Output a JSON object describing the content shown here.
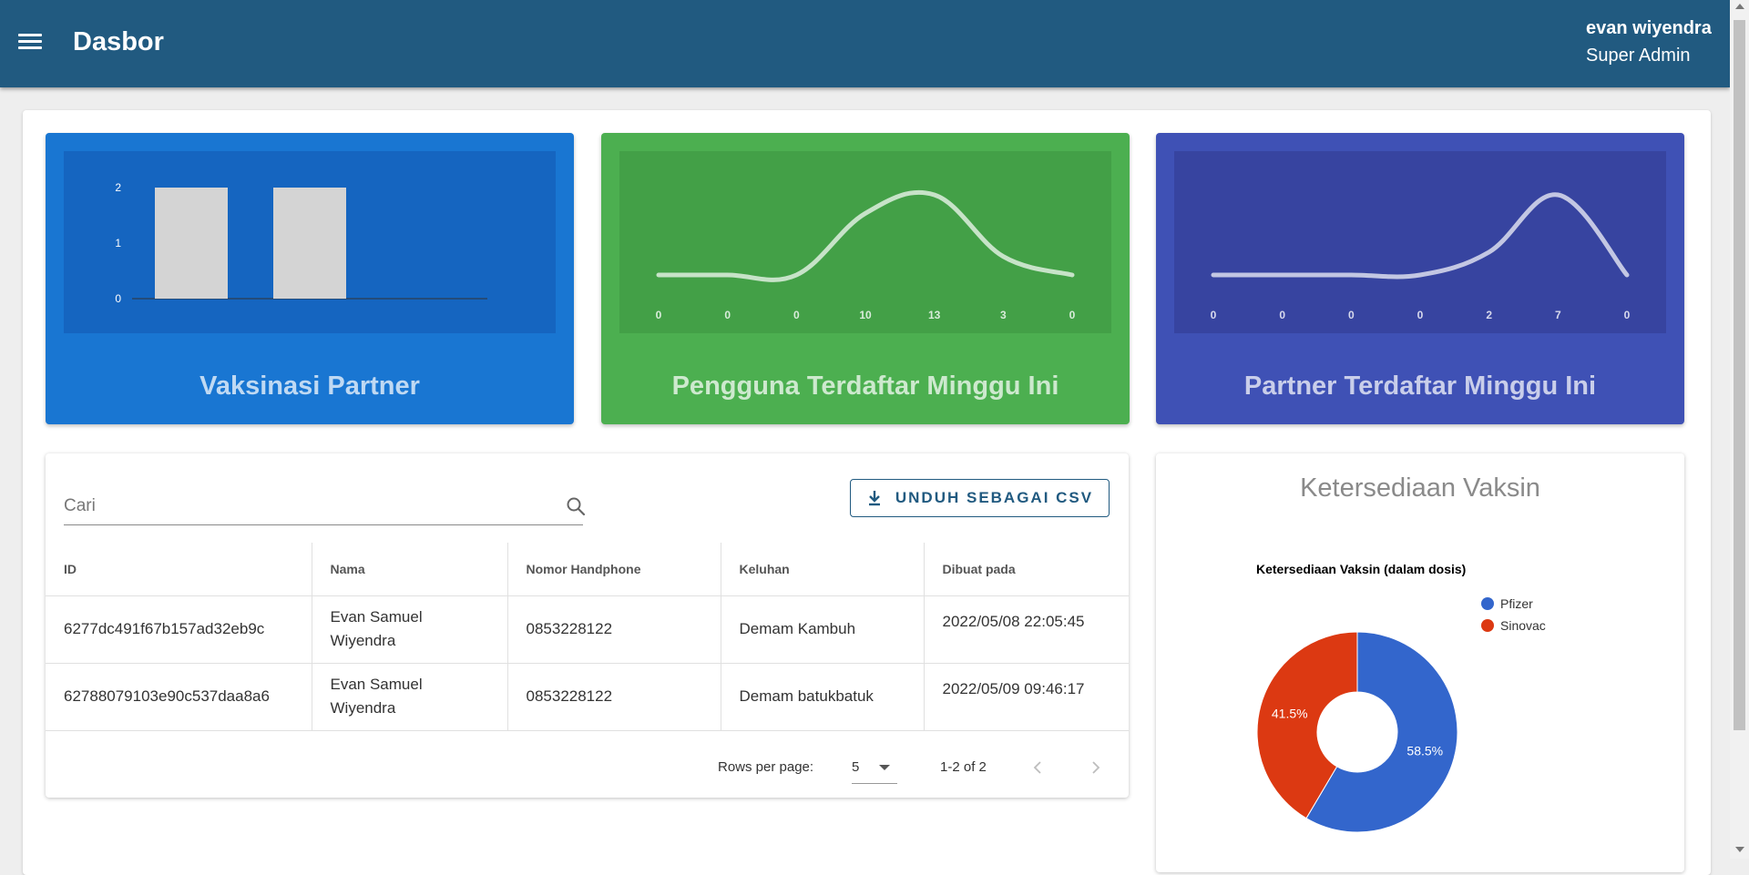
{
  "appbar": {
    "title": "Dasbor",
    "user_name": "evan wiyendra",
    "user_role": "Super Admin",
    "menu_icon": "hamburger-menu-icon",
    "background": "#215a80"
  },
  "cards": {
    "vaksinasi_partner": {
      "title": "Vaksinasi Partner",
      "color": "#1976d2"
    },
    "pengguna_terdaftar": {
      "title": "Pengguna Terdaftar Minggu Ini",
      "color": "#4caf50"
    },
    "partner_terdaftar": {
      "title": "Partner Terdaftar Minggu Ini",
      "color": "#3f51b5"
    }
  },
  "table": {
    "search_placeholder": "Cari",
    "csv_button": "UNDUH SEBAGAI CSV",
    "columns": [
      "ID",
      "Nama",
      "Nomor Handphone",
      "Keluhan",
      "Dibuat pada"
    ],
    "rows": [
      [
        "6277dc491f67b157ad32eb9c",
        "Evan Samuel Wiyendra",
        "0853228122",
        "Demam Kambuh",
        "2022/05/08 22:05:45"
      ],
      [
        "62788079103e90c537daa8a6",
        "Evan Samuel Wiyendra",
        "0853228122",
        "Demam batukbatuk",
        "2022/05/09 09:46:17"
      ]
    ],
    "pagination": {
      "rows_per_page_label": "Rows per page:",
      "rows_per_page": "5",
      "range": "1-2 of 2"
    }
  },
  "vaccine_card": {
    "title": "Ketersediaan Vaksin"
  },
  "chart_data": [
    {
      "type": "bar",
      "categories": [
        "",
        "",
        "",
        "",
        ""
      ],
      "values": [
        2,
        2,
        0,
        0,
        0
      ],
      "yticks": [
        "0",
        "1",
        "2"
      ],
      "ylim": [
        0,
        2
      ],
      "grid": false
    },
    {
      "type": "line",
      "x_labels": [
        "0",
        "0",
        "0",
        "10",
        "13",
        "3",
        "0"
      ],
      "values": [
        0,
        0,
        0,
        10,
        13,
        3,
        0
      ],
      "grid": false
    },
    {
      "type": "line",
      "x_labels": [
        "0",
        "0",
        "0",
        "0",
        "2",
        "7",
        "0"
      ],
      "values": [
        0,
        0,
        0,
        0,
        2,
        7,
        0
      ],
      "grid": false
    },
    {
      "type": "pie",
      "title": "Ketersediaan Vaksin (dalam dosis)",
      "legend_position": "top-right",
      "slices": [
        {
          "label": "Pfizer",
          "percent": 58.5,
          "display": "58.5%",
          "color": "#3366cc"
        },
        {
          "label": "Sinovac",
          "percent": 41.5,
          "display": "41.5%",
          "color": "#dc3912"
        }
      ]
    }
  ]
}
